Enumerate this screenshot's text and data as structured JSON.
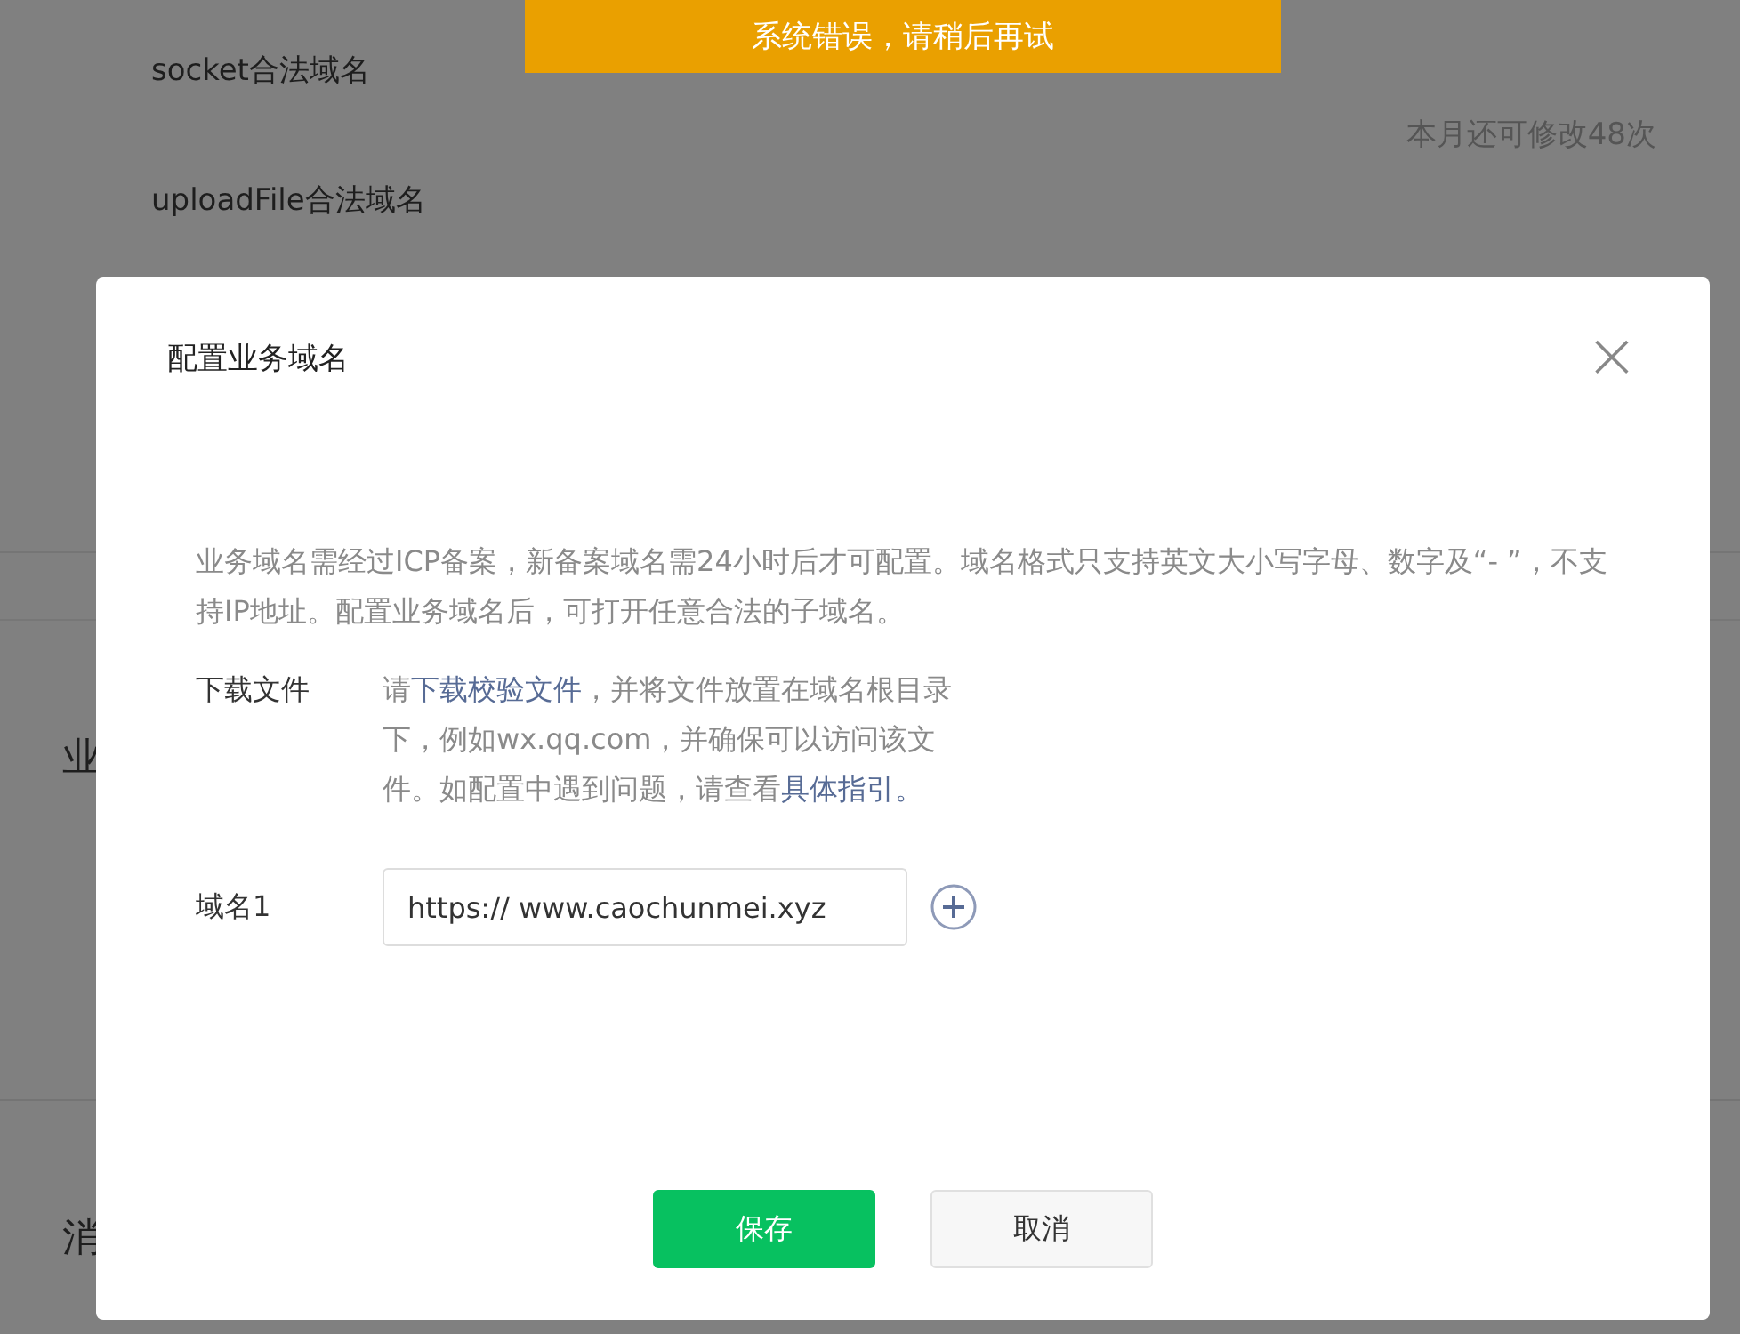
{
  "background_page": {
    "rows": [
      "socket合法域名",
      "uploadFile合法域名"
    ],
    "quota": "本月还可修改48次",
    "section_1": "业",
    "section_2": "消"
  },
  "toast": {
    "text": "系统错误，请稍后再试"
  },
  "dialog": {
    "title": "配置业务域名",
    "close": "×",
    "description": "业务域名需经过ICP备案，新备案域名需24小时后才可配置。域名格式只支持英文大小写字母、数字及“- ”，不支持IP地址。配置业务域名后，可打开任意合法的子域名。",
    "download": {
      "label": "下载文件",
      "segments": [
        {
          "kind": "text",
          "text": "请"
        },
        {
          "kind": "link",
          "text": "下载校验文件"
        },
        {
          "kind": "text",
          "text": "，并将文件放置在域名根目录下，例如wx.qq.com，并确保可以访问该文件。如配置中遇到问题，请查看"
        },
        {
          "kind": "link",
          "text": "具体指引。"
        }
      ]
    },
    "domains": [
      {
        "label": "域名1",
        "value": "https:// www.caochunmei.xyz"
      }
    ],
    "buttons": [
      {
        "kind": "primary",
        "label": "保存"
      },
      {
        "kind": "default",
        "label": "取消"
      }
    ]
  }
}
